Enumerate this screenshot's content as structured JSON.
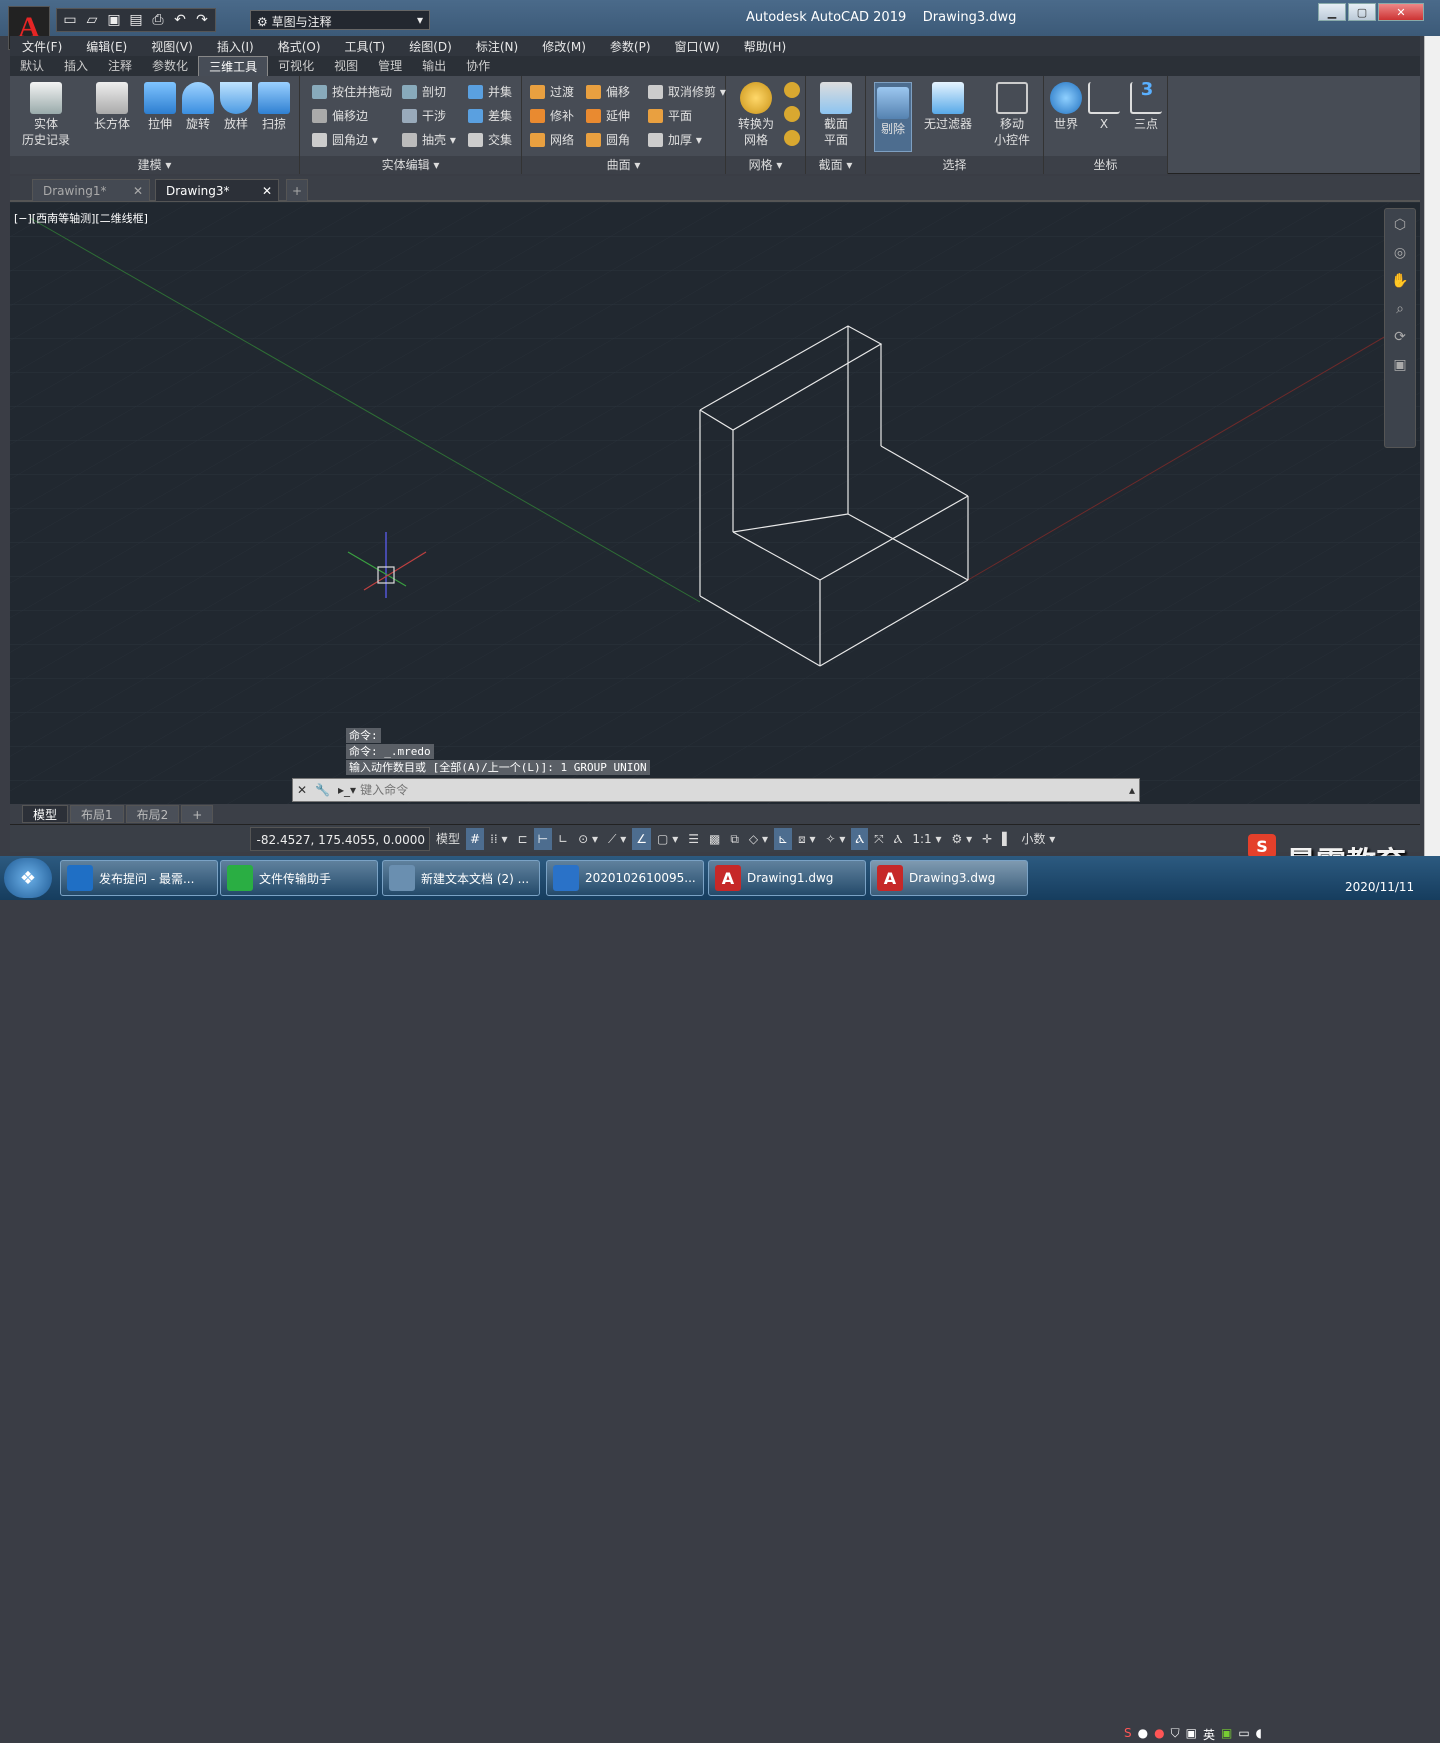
{
  "app": {
    "title": "Autodesk AutoCAD 2019",
    "document": "Drawing3.dwg",
    "logo_letter": "A",
    "workspace": "草图与注释"
  },
  "menubar": [
    "文件(F)",
    "编辑(E)",
    "视图(V)",
    "插入(I)",
    "格式(O)",
    "工具(T)",
    "绘图(D)",
    "标注(N)",
    "修改(M)",
    "参数(P)",
    "窗口(W)",
    "帮助(H)"
  ],
  "ribbon_tabs": [
    "默认",
    "插入",
    "注释",
    "参数化",
    "三维工具",
    "可视化",
    "视图",
    "管理",
    "输出",
    "协作"
  ],
  "ribbon_active_tab": "三维工具",
  "ribbon": {
    "modeling": {
      "label": "建模",
      "buttons": [
        "实体\n历史记录",
        "长方体",
        "拉伸",
        "旋转",
        "放样",
        "扫掠"
      ]
    },
    "solid_edit": {
      "label": "实体编辑",
      "items": [
        "按住并拖动",
        "偏移边",
        "圆角边",
        "剖切",
        "干涉",
        "抽壳",
        "并集",
        "差集",
        "交集"
      ]
    },
    "surface": {
      "label": "曲面",
      "items": [
        "过渡",
        "修补",
        "网络",
        "偏移",
        "延伸",
        "圆角",
        "取消修剪",
        "平面",
        "加厚"
      ]
    },
    "mesh": {
      "label": "网格",
      "buttons": [
        "转换为\n网格"
      ]
    },
    "section": {
      "label": "截面",
      "buttons": [
        "截面\n平面"
      ]
    },
    "selection": {
      "label": "选择",
      "buttons": [
        "剔除",
        "无过滤器",
        "移动\n小控件"
      ]
    },
    "coords": {
      "label": "坐标",
      "buttons": [
        "世界",
        "X",
        "三点"
      ]
    }
  },
  "doc_tabs": [
    "Drawing1*",
    "Drawing3*"
  ],
  "active_doc_tab": "Drawing3*",
  "viewport_label": "[−][西南等轴测][二维线框]",
  "command_history": [
    "命令:",
    "命令: _.mredo",
    "输入动作数目或 [全部(A)/上一个(L)]: 1 GROUP UNION"
  ],
  "command_placeholder": "键入命令",
  "layout_tabs": [
    "模型",
    "布局1",
    "布局2"
  ],
  "active_layout": "模型",
  "status": {
    "coords": "-82.4527, 175.4055, 0.0000",
    "model": "模型",
    "scale": "1:1",
    "units": "小数"
  },
  "taskbar": [
    {
      "label": "发布提问 - 最需...",
      "icon": "ie-icon",
      "color": "#1f6fc5"
    },
    {
      "label": "文件传输助手",
      "icon": "wechat-icon",
      "color": "#2aae43"
    },
    {
      "label": "新建文本文档 (2) ...",
      "icon": "notepad-icon",
      "color": "#6a8fb0"
    },
    {
      "label": "2020102610095...",
      "icon": "video-icon",
      "color": "#2a72c8"
    },
    {
      "label": "Drawing1.dwg",
      "icon": "autocad-icon",
      "color": "#c62828"
    },
    {
      "label": "Drawing3.dwg",
      "icon": "autocad-icon",
      "color": "#c62828"
    }
  ],
  "tray": {
    "ime": "英",
    "date": "2020/11/11"
  },
  "watermark": "最需教育",
  "colors": {
    "viewport": "#212830",
    "accent": "#4d6d8f"
  }
}
